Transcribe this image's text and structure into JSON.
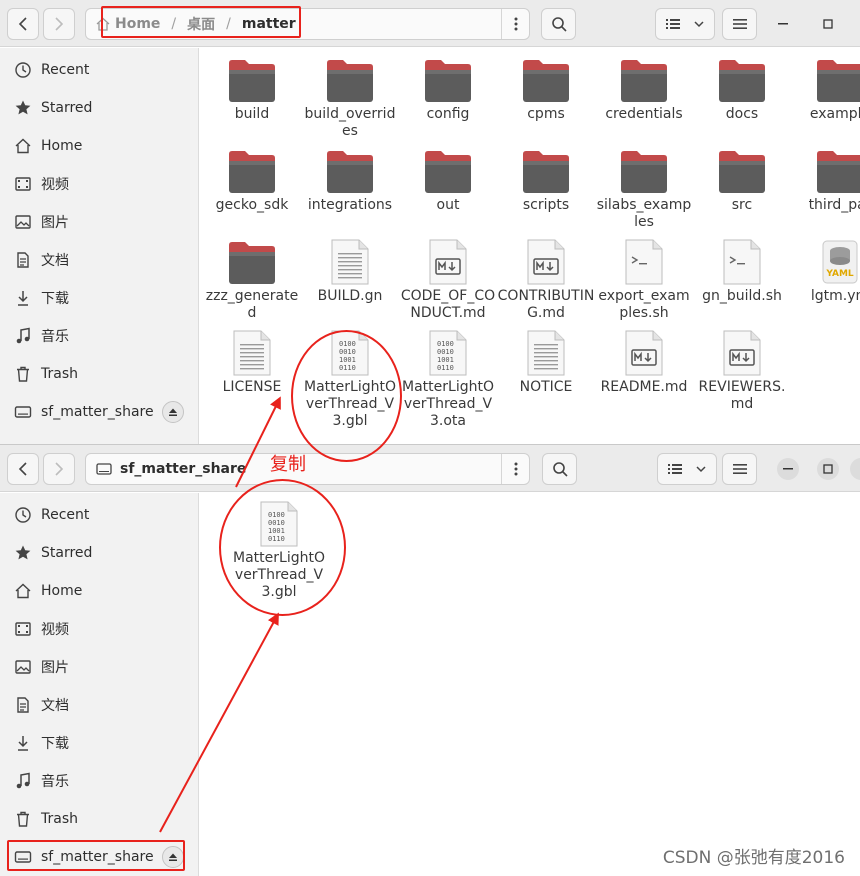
{
  "window1": {
    "breadcrumb": {
      "home": "Home",
      "desktop": "桌面",
      "current": "matter"
    },
    "sidebar": {
      "items": [
        {
          "label": "Recent",
          "icon": "recent-icon"
        },
        {
          "label": "Starred",
          "icon": "star-icon"
        },
        {
          "label": "Home",
          "icon": "home-icon"
        },
        {
          "label": "视频",
          "icon": "video-icon"
        },
        {
          "label": "图片",
          "icon": "picture-icon"
        },
        {
          "label": "文档",
          "icon": "document-icon"
        },
        {
          "label": "下载",
          "icon": "download-icon"
        },
        {
          "label": "音乐",
          "icon": "music-icon"
        },
        {
          "label": "Trash",
          "icon": "trash-icon"
        },
        {
          "label": "sf_matter_share",
          "icon": "drive-icon"
        }
      ]
    },
    "files": [
      {
        "name": "build",
        "type": "folder"
      },
      {
        "name": "build_overrides",
        "type": "folder"
      },
      {
        "name": "config",
        "type": "folder"
      },
      {
        "name": "cpms",
        "type": "folder"
      },
      {
        "name": "credentials",
        "type": "folder"
      },
      {
        "name": "docs",
        "type": "folder"
      },
      {
        "name": "example",
        "type": "folder"
      },
      {
        "name": "gecko_sdk",
        "type": "folder"
      },
      {
        "name": "integrations",
        "type": "folder"
      },
      {
        "name": "out",
        "type": "folder"
      },
      {
        "name": "scripts",
        "type": "folder"
      },
      {
        "name": "silabs_examples",
        "type": "folder"
      },
      {
        "name": "src",
        "type": "folder"
      },
      {
        "name": "third_par",
        "type": "folder"
      },
      {
        "name": "zzz_generated",
        "type": "folder"
      },
      {
        "name": "BUILD.gn",
        "type": "text"
      },
      {
        "name": "CODE_OF_CONDUCT.md",
        "type": "markdown"
      },
      {
        "name": "CONTRIBUTING.md",
        "type": "markdown"
      },
      {
        "name": "export_examples.sh",
        "type": "script"
      },
      {
        "name": "gn_build.sh",
        "type": "script"
      },
      {
        "name": "lgtm.ym",
        "type": "yaml"
      },
      {
        "name": "LICENSE",
        "type": "text"
      },
      {
        "name": "MatterLightOverThread_V3.gbl",
        "type": "binary"
      },
      {
        "name": "MatterLightOverThread_V3.ota",
        "type": "binary"
      },
      {
        "name": "NOTICE",
        "type": "text"
      },
      {
        "name": "README.md",
        "type": "markdown"
      },
      {
        "name": "REVIEWERS.md",
        "type": "markdown"
      }
    ],
    "yaml_badge": "YAML"
  },
  "window2": {
    "breadcrumb": {
      "current": "sf_matter_share"
    },
    "sidebar": {
      "items": [
        {
          "label": "Recent"
        },
        {
          "label": "Starred"
        },
        {
          "label": "Home"
        },
        {
          "label": "视频"
        },
        {
          "label": "图片"
        },
        {
          "label": "文档"
        },
        {
          "label": "下载"
        },
        {
          "label": "音乐"
        },
        {
          "label": "Trash"
        },
        {
          "label": "sf_matter_share"
        }
      ]
    },
    "files": [
      {
        "name": "MatterLightOverThread_V3.gbl",
        "type": "binary"
      }
    ]
  },
  "annotation": {
    "copy_label": "复制",
    "color": "#e8221c"
  },
  "binary_glyph": [
    "0100",
    "0010",
    "1001",
    "0110"
  ],
  "watermark": "CSDN @张弛有度2016",
  "colors": {
    "folder_top": "#c24a4a",
    "folder_body": "#5c5c5c",
    "accent": "#e8221c"
  }
}
